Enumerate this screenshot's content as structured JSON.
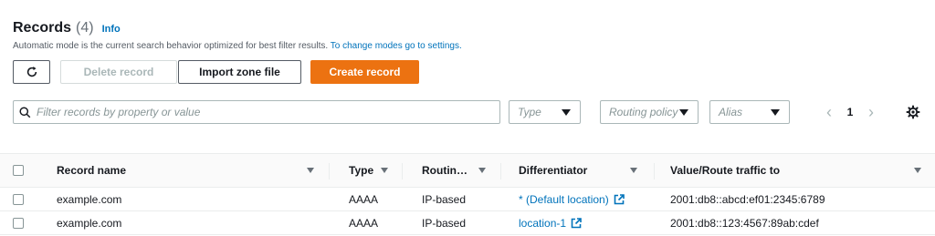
{
  "header": {
    "title": "Records",
    "count": "(4)",
    "info_label": "Info",
    "subtitle": "Automatic mode is the current search behavior optimized for best filter results.",
    "subtitle_link": "To change modes go to settings."
  },
  "toolbar": {
    "refresh_icon": "refresh-icon",
    "delete_label": "Delete record",
    "import_label": "Import zone file",
    "create_label": "Create record"
  },
  "colors": {
    "primary_button": "#ec7211",
    "link": "#0073bb",
    "disabled": "#aab7b8"
  },
  "filters": {
    "search_placeholder": "Filter records by property or value",
    "type_placeholder": "Type",
    "routing_placeholder": "Routing policy",
    "alias_placeholder": "Alias"
  },
  "pagination": {
    "current_page": "1",
    "prev_icon": "chevron-left-icon",
    "next_icon": "chevron-right-icon",
    "settings_icon": "gear-icon"
  },
  "table": {
    "columns": {
      "name": "Record name",
      "type": "Type",
      "routing": "Routin…",
      "differentiator": "Differentiator",
      "value": "Value/Route traffic to"
    },
    "rows": [
      {
        "name": "example.com",
        "type": "AAAA",
        "routing": "IP-based",
        "differentiator": "* (Default location)",
        "value": "2001:db8::abcd:ef01:2345:6789"
      },
      {
        "name": "example.com",
        "type": "AAAA",
        "routing": "IP-based",
        "differentiator": "location-1",
        "value": "2001:db8::123:4567:89ab:cdef"
      }
    ]
  }
}
